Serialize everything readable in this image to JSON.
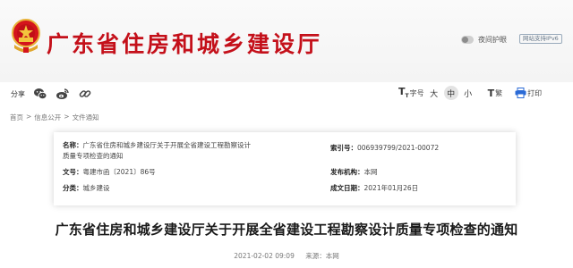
{
  "header": {
    "site_title": "广东省住房和城乡建设厅",
    "night_mode_label": "夜间护眼",
    "ipv6_badge": "网站支持IPv6",
    "emblem_icon": "national-emblem-icon",
    "title_color": "#c4101a"
  },
  "toolbar": {
    "share_label": "分享",
    "share_icons": [
      "wechat-icon",
      "weibo-icon",
      "link-icon"
    ],
    "font_size_label": "字号",
    "size_large": "大",
    "size_medium": "中",
    "size_small": "小",
    "traditional_label": "繁",
    "print_label": "打印"
  },
  "breadcrumb": {
    "home": "首页",
    "sep": ">",
    "level1": "信息公开",
    "level2": "文件通知"
  },
  "meta": {
    "name_label": "名称：",
    "name_value": "广东省住房和城乡建设厅关于开展全省建设工程勘察设计质量专项检查的通知",
    "index_label": "索引号：",
    "index_value": "006939799/2021-00072",
    "docno_label": "文号：",
    "docno_value": "粤建市函〔2021〕86号",
    "issuer_label": "发布机构：",
    "issuer_value": "本网",
    "category_label": "分类：",
    "category_value": "城乡建设",
    "date_label": "成文日期：",
    "date_value": "2021年01月26日"
  },
  "article": {
    "title": "广东省住房和城乡建设厅关于开展全省建设工程勘察设计质量专项检查的通知",
    "publish_time": "2021-02-02  09:09",
    "source": "来源：本网"
  }
}
